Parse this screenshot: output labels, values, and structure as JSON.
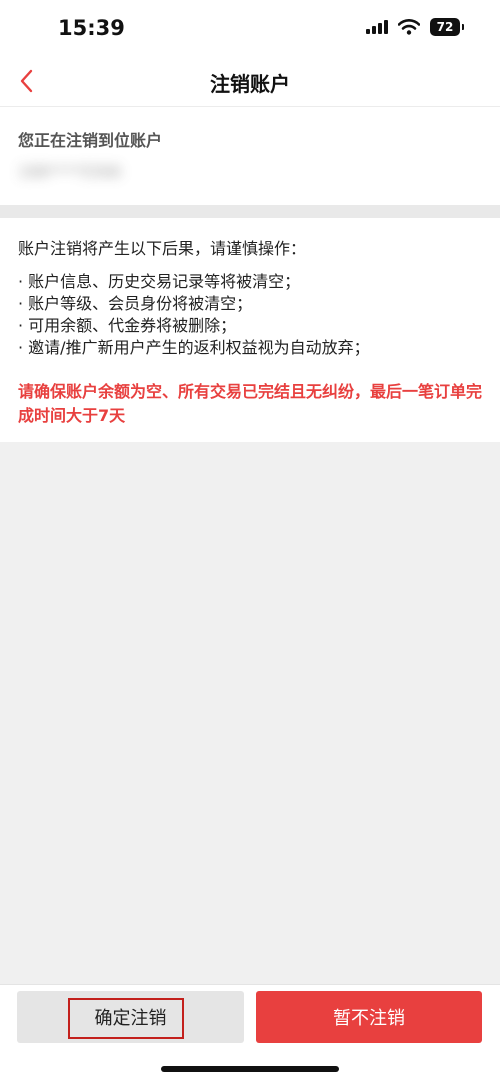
{
  "status_bar": {
    "time": "15:39",
    "battery": "72",
    "icons": [
      "signal-icon",
      "wifi-icon",
      "battery-icon"
    ]
  },
  "nav": {
    "title": "注销账户",
    "back_icon": "chevron-left-icon"
  },
  "account": {
    "heading": "您正在注销到位账户",
    "number": "188****5566"
  },
  "notice": {
    "intro": "账户注销将产生以下后果，请谨慎操作：",
    "items": [
      "· 账户信息、历史交易记录等将被清空；",
      "· 账户等级、会员身份将被清空；",
      "· 可用余额、代金券将被删除；",
      "· 邀请/推广新用户产生的返利权益视为自动放弃；"
    ],
    "warning": "请确保账户余额为空、所有交易已完结且无纠纷，最后一笔订单完成时间大于7天"
  },
  "actions": {
    "confirm_label": "确定注销",
    "cancel_label": "暂不注销"
  },
  "colors": {
    "accent": "#e8403f",
    "highlight_box": "#c3201c",
    "background": "#f0f0f0"
  }
}
